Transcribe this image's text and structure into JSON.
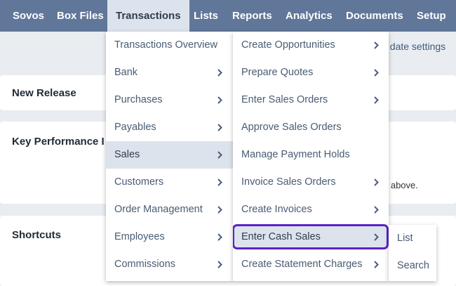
{
  "nav": {
    "items": [
      "Sovos",
      "Box Files",
      "Transactions",
      "Lists",
      "Reports",
      "Analytics",
      "Documents",
      "Setup"
    ],
    "active": "Transactions"
  },
  "dashboard": {
    "settings_link": "t date settings",
    "card1_title": "New Release",
    "card2_title": "Key Performance I",
    "card2_note": "u above.",
    "card3_title": "Shortcuts"
  },
  "menu1": {
    "items": [
      {
        "label": "Transactions Overview",
        "arrow": false
      },
      {
        "label": "Bank",
        "arrow": true
      },
      {
        "label": "Purchases",
        "arrow": true
      },
      {
        "label": "Payables",
        "arrow": true
      },
      {
        "label": "Sales",
        "arrow": true,
        "highlighted": true
      },
      {
        "label": "Customers",
        "arrow": true
      },
      {
        "label": "Order Management",
        "arrow": true
      },
      {
        "label": "Employees",
        "arrow": true
      },
      {
        "label": "Commissions",
        "arrow": true
      }
    ]
  },
  "menu2": {
    "items": [
      {
        "label": "Create Opportunities",
        "arrow": true
      },
      {
        "label": "Prepare Quotes",
        "arrow": true
      },
      {
        "label": "Enter Sales Orders",
        "arrow": true
      },
      {
        "label": "Approve Sales Orders",
        "arrow": false
      },
      {
        "label": "Manage Payment Holds",
        "arrow": false
      },
      {
        "label": "Invoice Sales Orders",
        "arrow": true
      },
      {
        "label": "Create Invoices",
        "arrow": true
      },
      {
        "label": "Enter Cash Sales",
        "arrow": true,
        "outlined": true
      },
      {
        "label": "Create Statement Charges",
        "arrow": true
      }
    ]
  },
  "menu3": {
    "items": [
      {
        "label": "List"
      },
      {
        "label": "Search"
      }
    ]
  },
  "icons": {
    "submenu_arrow": "chevron-right-icon"
  },
  "colors": {
    "nav_bg": "#607799",
    "highlight": "#dde3ec",
    "focus_outline": "#5a23c8"
  }
}
